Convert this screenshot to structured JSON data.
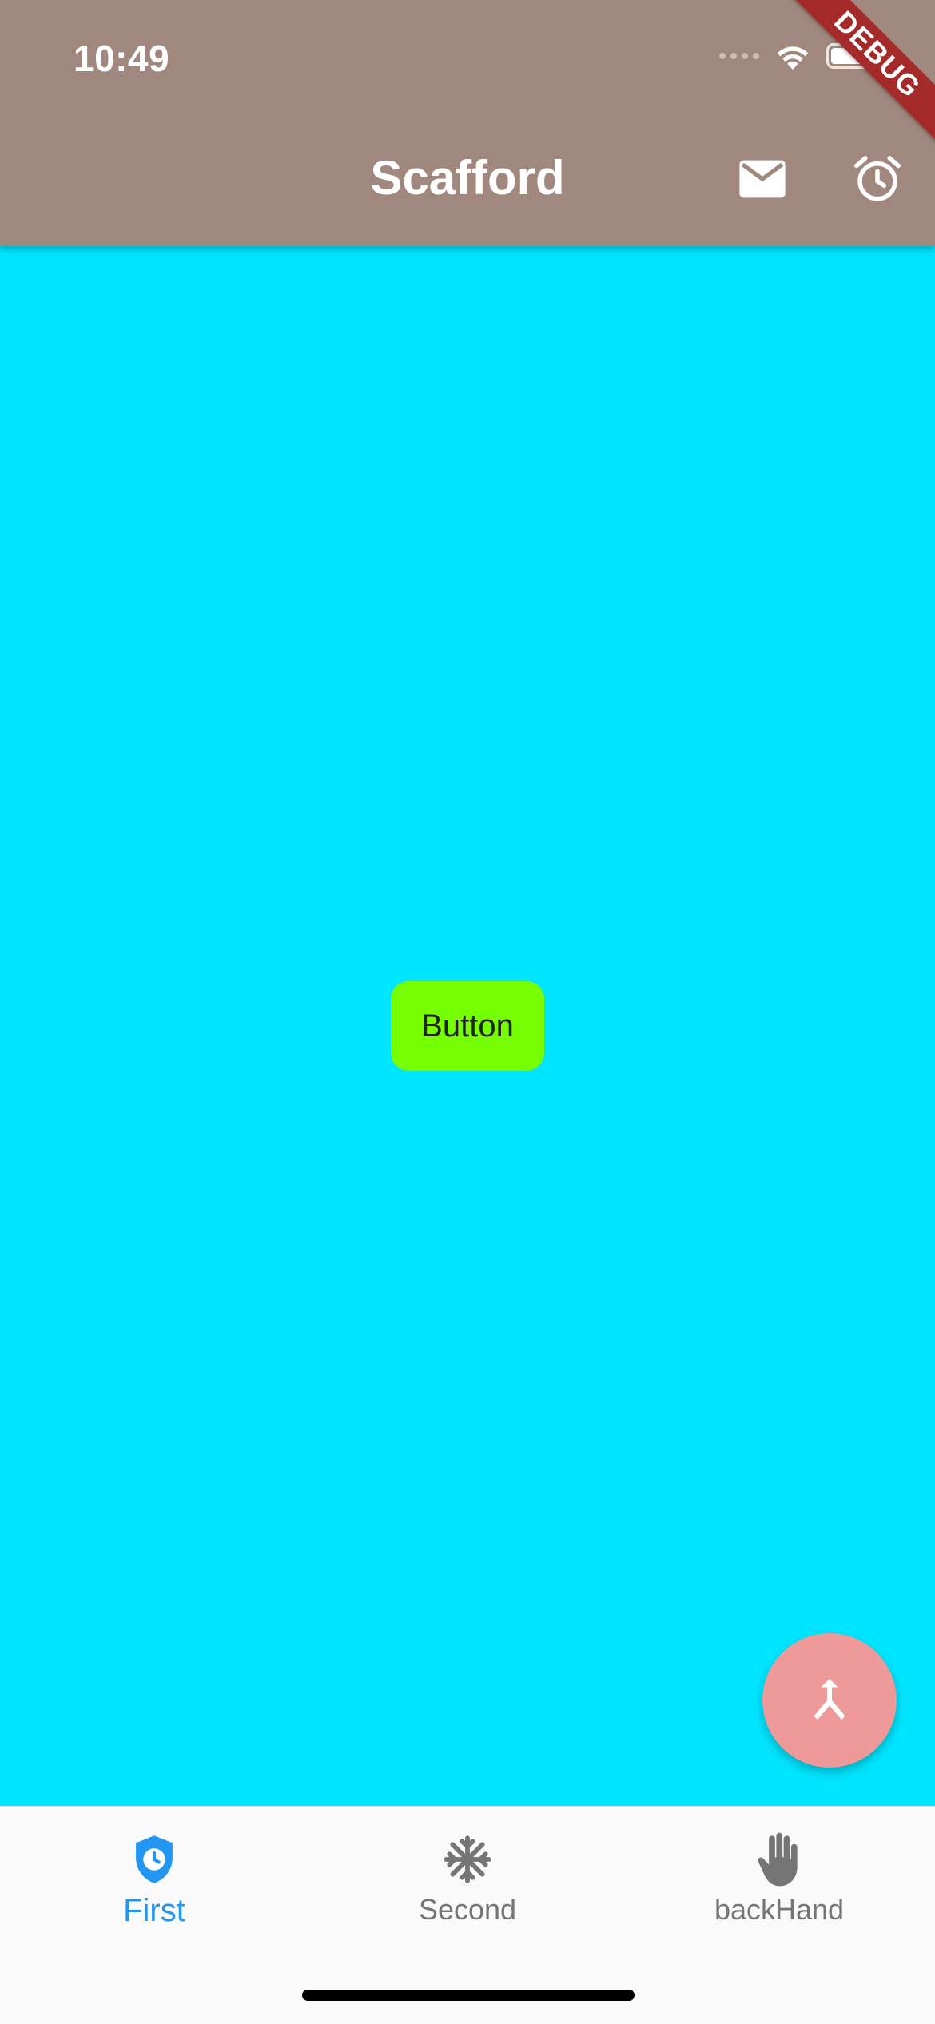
{
  "status_bar": {
    "time": "10:49"
  },
  "app_bar": {
    "title": "Scafford",
    "actions": [
      {
        "icon": "mail-icon"
      },
      {
        "icon": "alarm-icon"
      }
    ]
  },
  "debug_banner": "DEBUG",
  "body": {
    "background": "#00E5FF",
    "button_label": "Button",
    "button_color": "#76FF03"
  },
  "fab": {
    "icon": "merge-icon",
    "color": "#EF9A9A"
  },
  "bottom_nav": {
    "items": [
      {
        "label": "First",
        "icon": "shield-clock-icon",
        "selected": true
      },
      {
        "label": "Second",
        "icon": "snowflake-icon",
        "selected": false
      },
      {
        "label": "backHand",
        "icon": "back-hand-icon",
        "selected": false
      }
    ],
    "selected_color": "#2196F3",
    "unselected_color": "#757575"
  },
  "colors": {
    "app_bar": "#A1887F"
  }
}
